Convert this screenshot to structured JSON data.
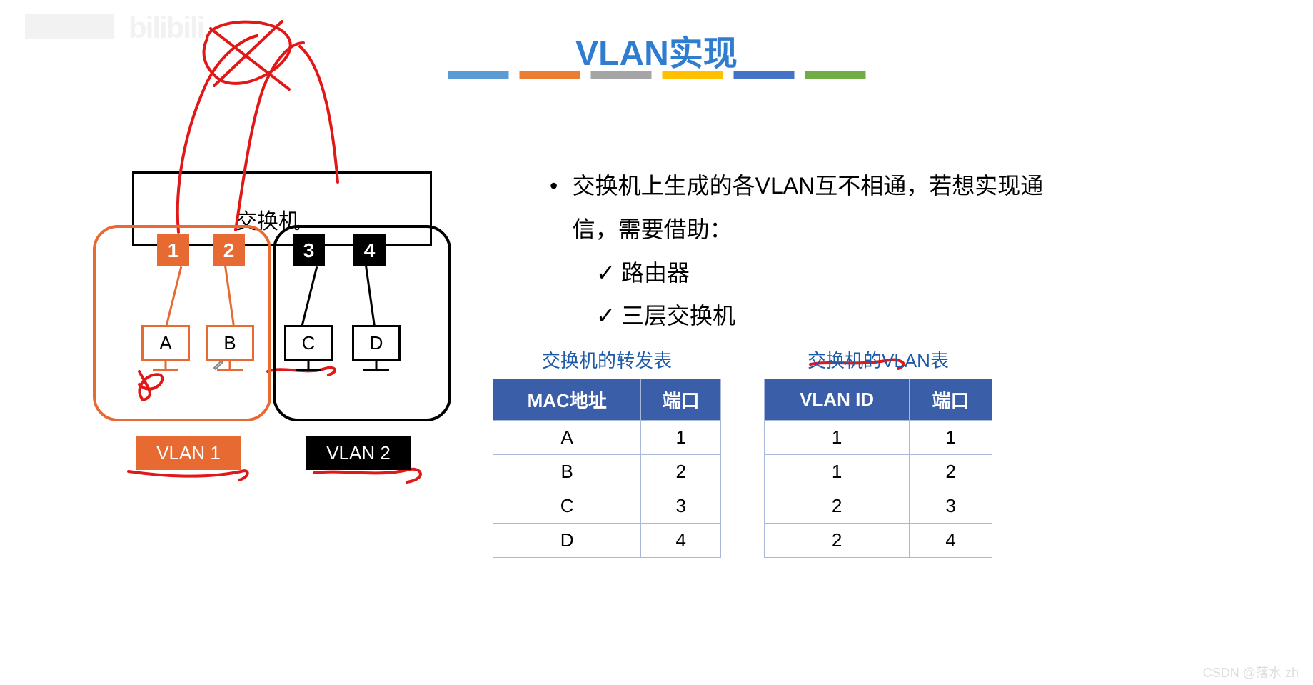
{
  "watermark_bilibili": "bilibili",
  "title": "VLAN实现",
  "diagram": {
    "switch_label": "交换机",
    "ports": [
      "1",
      "2",
      "3",
      "4"
    ],
    "hosts": [
      "A",
      "B",
      "C",
      "D"
    ],
    "vlan1_label": "VLAN 1",
    "vlan2_label": "VLAN 2"
  },
  "text": {
    "main": "交换机上生成的各VLAN互不相通，若想实现通信，需要借助：",
    "items": [
      "路由器",
      "三层交换机"
    ]
  },
  "table1": {
    "title": "交换机的转发表",
    "headers": [
      "MAC地址",
      "端口"
    ],
    "rows": [
      [
        "A",
        "1"
      ],
      [
        "B",
        "2"
      ],
      [
        "C",
        "3"
      ],
      [
        "D",
        "4"
      ]
    ]
  },
  "table2": {
    "title": "交换机的VLAN表",
    "headers": [
      "VLAN ID",
      "端口"
    ],
    "rows": [
      [
        "1",
        "1"
      ],
      [
        "1",
        "2"
      ],
      [
        "2",
        "3"
      ],
      [
        "2",
        "4"
      ]
    ]
  },
  "csdn": "CSDN @落水 zh"
}
